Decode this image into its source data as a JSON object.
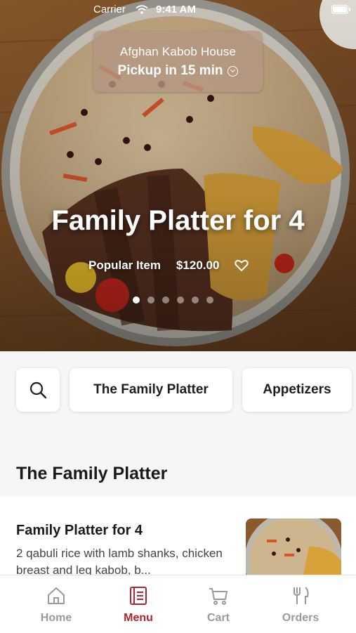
{
  "status_bar": {
    "carrier": "Carrier",
    "time": "9:41 AM"
  },
  "pickup": {
    "restaurant": "Afghan Kabob House",
    "eta": "Pickup in 15 min"
  },
  "hero": {
    "title": "Family Platter for 4",
    "tag": "Popular Item",
    "price": "$120.00",
    "carousel_total": 6,
    "carousel_active": 1
  },
  "categories": {
    "search_icon": "search-icon",
    "items": [
      "The Family Platter",
      "Appetizers"
    ]
  },
  "section": {
    "title": "The Family Platter"
  },
  "item": {
    "name": "Family Platter for 4",
    "description": "2 qabuli rice with lamb shanks, chicken breast and leg kabob, b..."
  },
  "tabs": [
    {
      "label": "Home",
      "icon": "home-icon"
    },
    {
      "label": "Menu",
      "icon": "menu-icon"
    },
    {
      "label": "Cart",
      "icon": "cart-icon"
    },
    {
      "label": "Orders",
      "icon": "orders-icon"
    }
  ],
  "colors": {
    "accent": "#b2232d",
    "inactive_tab": "#9a9a9a"
  }
}
